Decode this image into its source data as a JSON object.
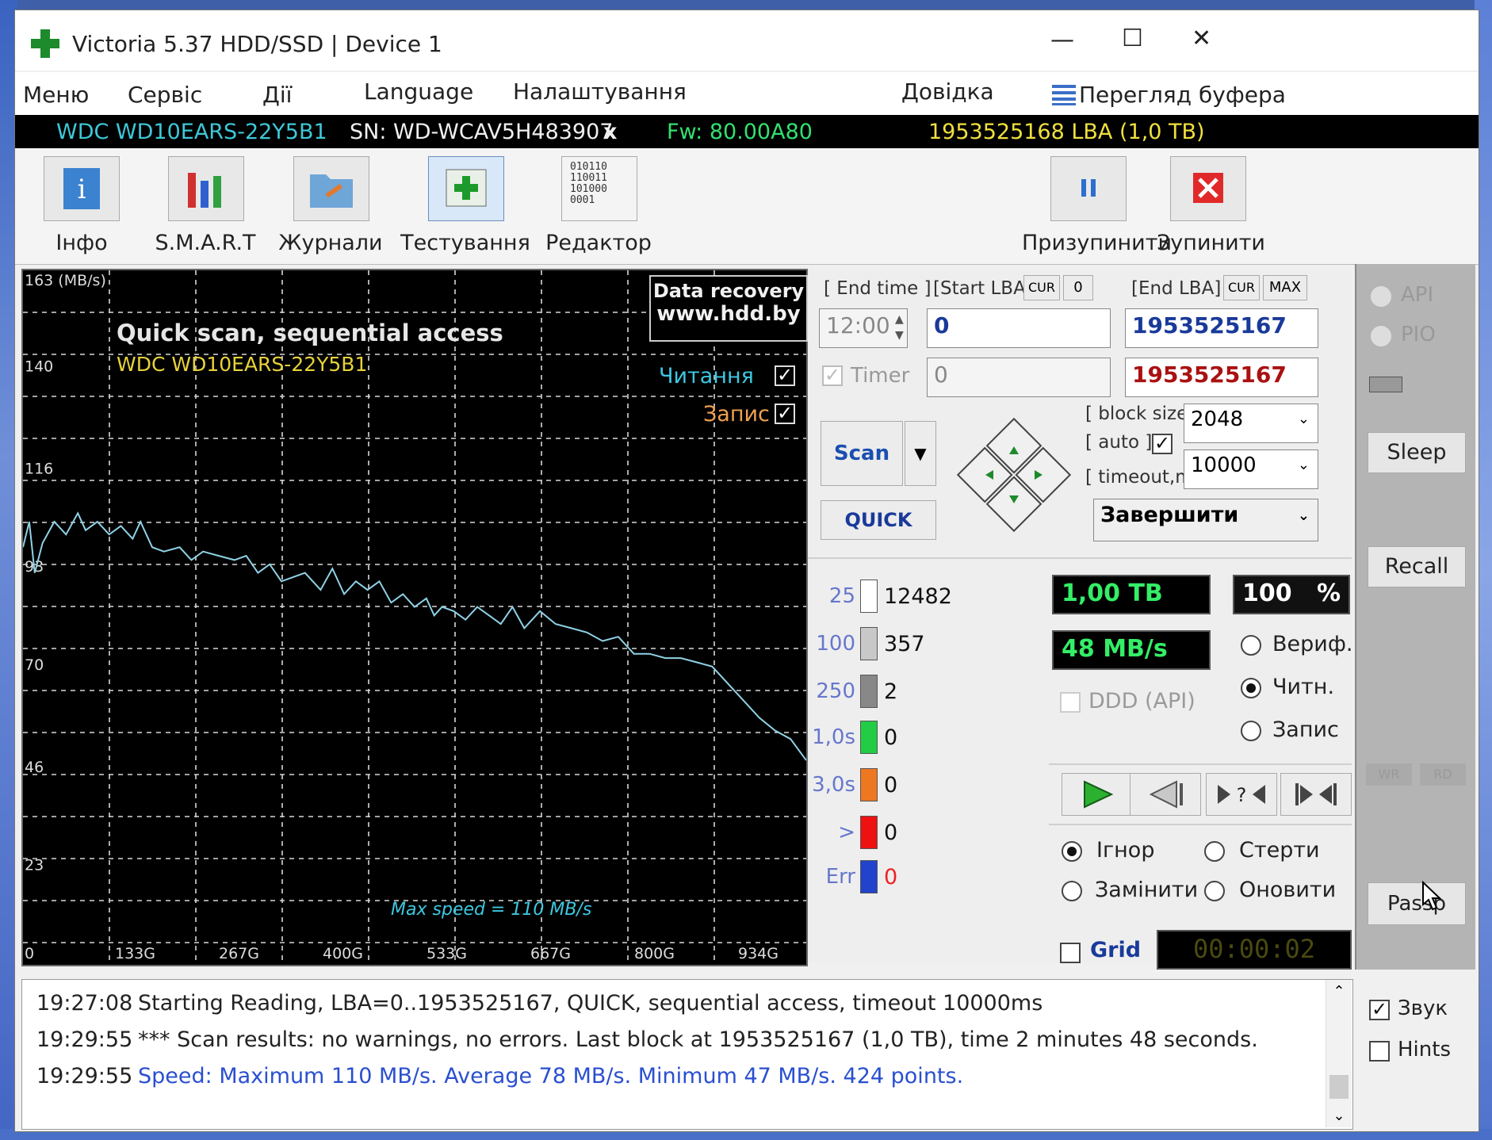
{
  "window": {
    "title": "Victoria 5.37 HDD/SSD | Device 1",
    "minimize_glyph": "—",
    "maximize_glyph": "☐",
    "close_glyph": "✕"
  },
  "menu": {
    "items": [
      "Меню",
      "Сервіс",
      "Дії",
      "Language",
      "Налаштування",
      "Довідка"
    ],
    "buffer_view": "Перегляд буфера"
  },
  "device": {
    "model": "WDC WD10EARS-22Y5B1",
    "serial": "SN: WD-WCAV5H483907",
    "x_glyph": "x",
    "firmware": "Fw: 80.00A80",
    "capacity": "1953525168 LBA (1,0 TB)"
  },
  "toolbar": {
    "info": "Інфо",
    "smart": "S.M.A.R.T",
    "logs": "Журнали",
    "testing": "Тестування",
    "editor": "Редактор",
    "editor_icon_text": "010110\n110011\n101000\n0001",
    "pause": "Призупинити",
    "stop": "Зупинити"
  },
  "graph": {
    "unit_label": "163 (MB/s)",
    "title": "Quick scan, sequential access",
    "drive": "WDC WD10EARS-22Y5B1",
    "promo_line1": "Data recovery",
    "promo_line2": "www.hdd.by",
    "read_label": "Читання",
    "write_label": "Запис",
    "max_speed_note": "Max speed = 110 MB/s"
  },
  "chart_data": {
    "type": "line",
    "title": "Quick scan, sequential access",
    "y_ticks": [
      "140",
      "116",
      "93",
      "70",
      "46",
      "23",
      "0"
    ],
    "x_ticks": [
      "133G",
      "267G",
      "400G",
      "533G",
      "667G",
      "800G",
      "934G"
    ],
    "ylim": [
      0,
      163
    ],
    "xlim": [
      0,
      1000
    ],
    "series": [
      {
        "name": "Читання",
        "color": "#8fd2e6",
        "x": [
          0,
          8,
          15,
          25,
          40,
          55,
          70,
          80,
          95,
          110,
          125,
          140,
          150,
          165,
          180,
          200,
          215,
          230,
          250,
          270,
          285,
          300,
          315,
          330,
          345,
          360,
          380,
          395,
          410,
          425,
          440,
          455,
          470,
          485,
          500,
          515,
          525,
          535,
          550,
          565,
          580,
          595,
          610,
          625,
          640,
          660,
          680,
          700,
          720,
          740,
          760,
          780,
          800,
          820,
          840,
          860,
          880,
          900,
          920,
          940,
          960,
          980,
          1000
        ],
        "y": [
          98,
          104,
          92,
          99,
          104,
          101,
          106,
          102,
          104,
          101,
          103,
          100,
          104,
          98,
          97,
          98,
          95,
          97,
          96,
          95,
          96,
          92,
          94,
          90,
          91,
          92,
          88,
          93,
          87,
          90,
          88,
          90,
          85,
          87,
          84,
          86,
          82,
          84,
          83,
          81,
          84,
          82,
          80,
          84,
          79,
          83,
          80,
          79,
          78,
          76,
          77,
          73,
          73,
          72,
          72,
          71,
          70,
          66,
          62,
          58,
          55,
          53,
          48
        ]
      }
    ]
  },
  "controls": {
    "end_time_label": "[ End time ]",
    "end_time_value": "12:00",
    "timer_label": "Timer",
    "start_lba_label": "[Start LBA]",
    "cur": "CUR",
    "zero": "0",
    "start_lba": "0",
    "start_lba_cur": "0",
    "end_lba_label": "[End LBA]",
    "max": "MAX",
    "end_lba": "1953525167",
    "end_lba_cur": "1953525167",
    "block_size_label": "[ block size ]",
    "auto_label": "[ auto ]",
    "block_size": "2048",
    "timeout_label": "[ timeout,ms ]",
    "timeout": "10000",
    "scan": "Scan",
    "quick": "QUICK",
    "finish_action": "Завершити"
  },
  "legend": [
    {
      "label": "25",
      "count": "12482",
      "color": "#ffffff"
    },
    {
      "label": "100",
      "count": "357",
      "color": "#c8c8c8"
    },
    {
      "label": "250",
      "count": "2",
      "color": "#888888"
    },
    {
      "label": "1,0s",
      "count": "0",
      "color": "#22cc44"
    },
    {
      "label": "3,0s",
      "count": "0",
      "color": "#ee7722"
    },
    {
      "label": ">",
      "count": "0",
      "color": "#ee1111"
    },
    {
      "label": "Err",
      "count": "0",
      "color": "#2244cc"
    }
  ],
  "status": {
    "size": "1,00 TB",
    "percent": "100",
    "percent_sign": "%",
    "speed": "48 MB/s",
    "ddd": "DDD (API)",
    "verify": "Вериф.",
    "read": "Читн.",
    "write": "Запис",
    "ignore": "Ігнор",
    "erase": "Стерти",
    "replace": "Замінити",
    "refresh": "Оновити",
    "grid": "Grid",
    "timer": "00:00:02"
  },
  "side": {
    "api": "API",
    "pio": "PIO",
    "sleep": "Sleep",
    "recall": "Recall",
    "wr": "WR",
    "rd": "RD",
    "passp": "Passp",
    "sound": "Звук",
    "hints": "Hints"
  },
  "log": [
    {
      "time": "19:27:08",
      "msg": "Starting Reading, LBA=0..1953525167, QUICK, sequential access, timeout 10000ms",
      "color": "#222222"
    },
    {
      "time": "19:29:55",
      "msg": "*** Scan results: no warnings, no errors. Last block at 1953525167 (1,0 TB), time 2 minutes 48 seconds.",
      "color": "#222222"
    },
    {
      "time": "19:29:55",
      "msg": "Speed: Maximum 110 MB/s. Average 78 MB/s. Minimum 47 MB/s. 424 points.",
      "color": "#2a4fd0"
    }
  ]
}
